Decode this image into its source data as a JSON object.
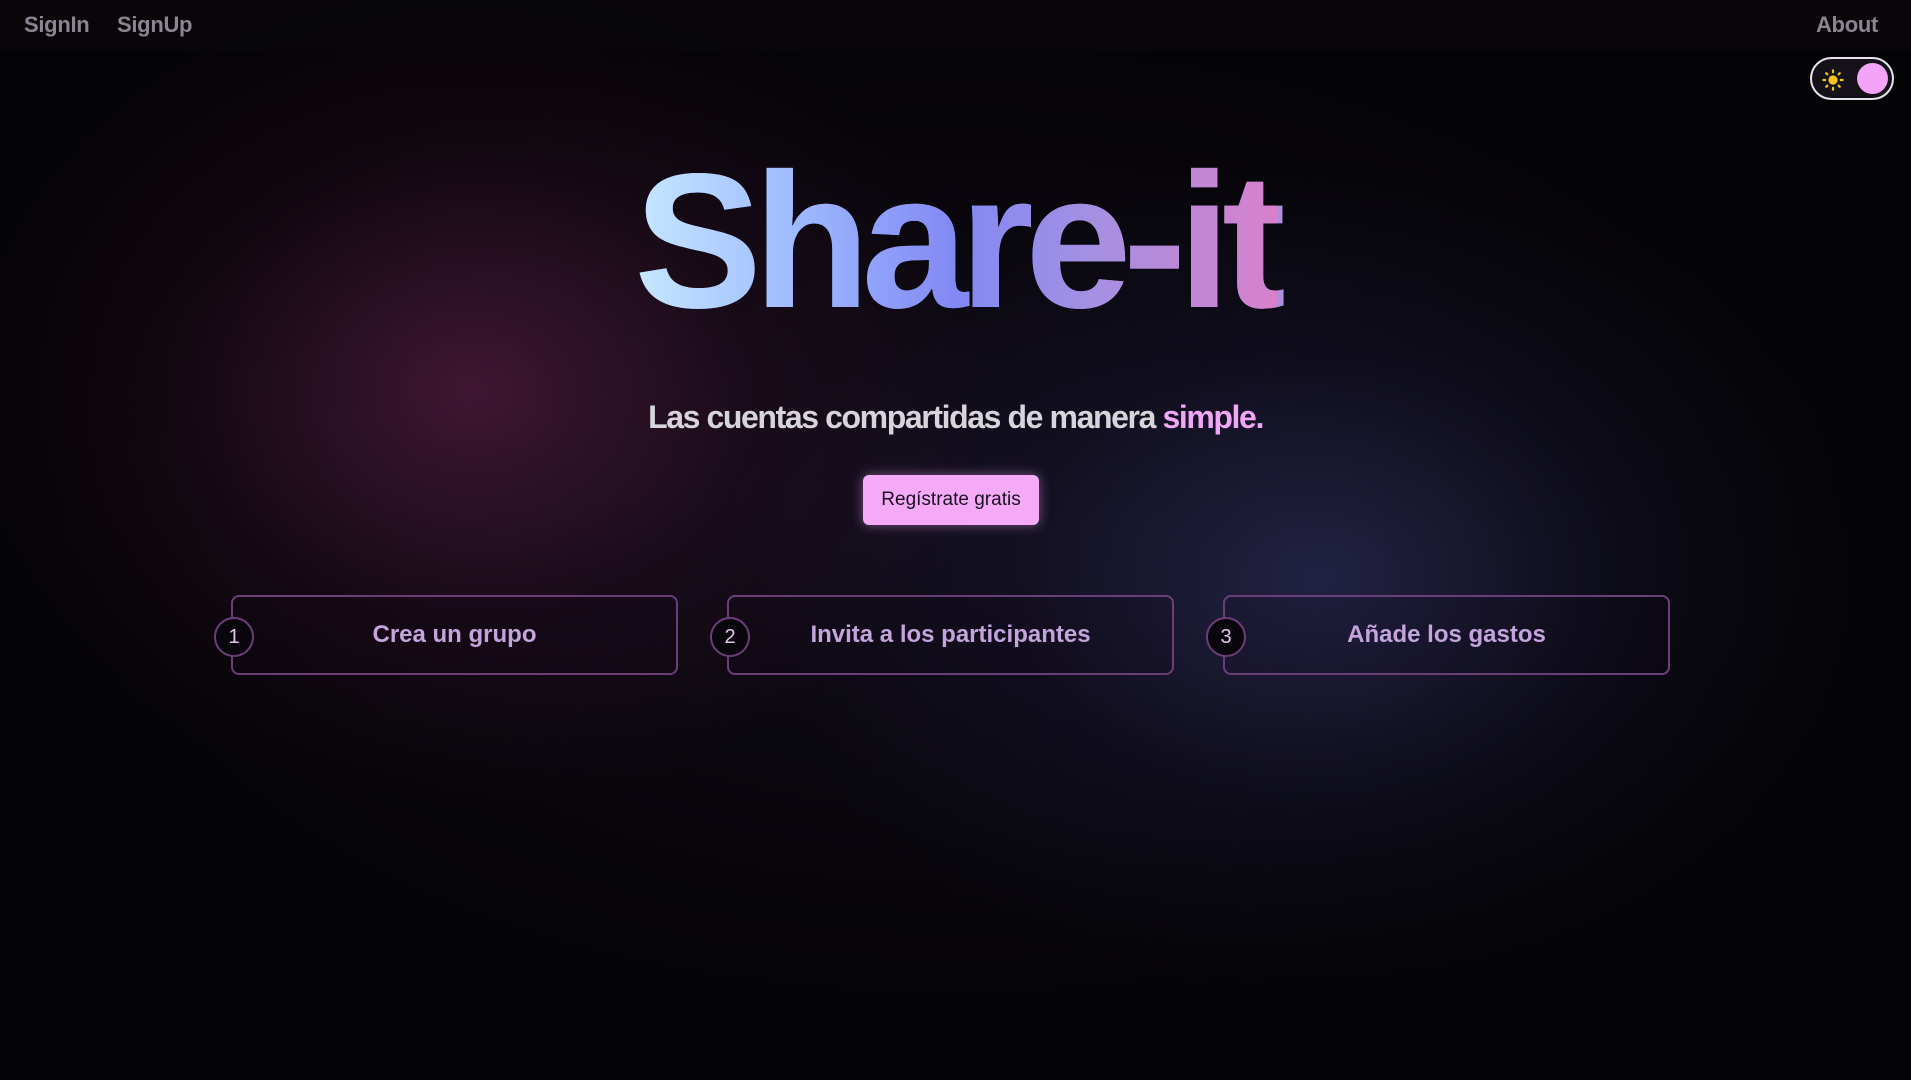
{
  "nav": {
    "signin": "SignIn",
    "signup": "SignUp",
    "about": "About"
  },
  "theme_toggle": {
    "icon": "sun-icon",
    "state": "dark"
  },
  "hero": {
    "title": "Share-it",
    "tagline_main": "Las cuentas compartidas de manera ",
    "tagline_accent": "simple."
  },
  "cta": {
    "label": "Regístrate gratis"
  },
  "steps": [
    {
      "number": "1",
      "label": "Crea un grupo"
    },
    {
      "number": "2",
      "label": "Invita a los participantes"
    },
    {
      "number": "3",
      "label": "Añade los gastos"
    }
  ],
  "colors": {
    "background": "#040305",
    "accent_pink": "#f5aaf8",
    "step_border": "#6a3f78",
    "step_text": "#c4a4dc",
    "sun": "#f5c518"
  }
}
